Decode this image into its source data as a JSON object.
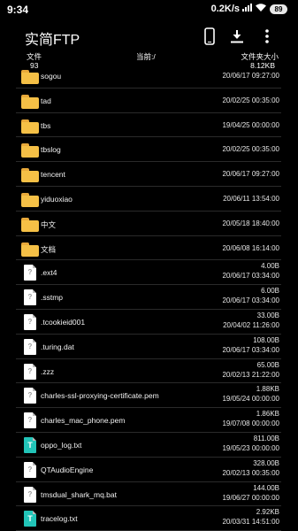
{
  "status_bar": {
    "time": "9:34",
    "speed": "0.2K/s",
    "battery": "89"
  },
  "title_bar": {
    "title": "实简FTP"
  },
  "header": {
    "left_label": "文件",
    "left_count": "93",
    "center_path": "当前:/",
    "right_label": "文件夹大小",
    "right_size": "8.12KB"
  },
  "files": [
    {
      "name": "sogou",
      "type": "folder",
      "size": "",
      "date": "20/06/17 09:27:00"
    },
    {
      "name": "tad",
      "type": "folder",
      "size": "",
      "date": "20/02/25 00:35:00"
    },
    {
      "name": "tbs",
      "type": "folder",
      "size": "",
      "date": "19/04/25 00:00:00"
    },
    {
      "name": "tbslog",
      "type": "folder",
      "size": "",
      "date": "20/02/25 00:35:00"
    },
    {
      "name": "tencent",
      "type": "folder",
      "size": "",
      "date": "20/06/17 09:27:00"
    },
    {
      "name": "yiduoxiao",
      "type": "folder",
      "size": "",
      "date": "20/06/11 13:54:00"
    },
    {
      "name": "中文",
      "type": "folder",
      "size": "",
      "date": "20/05/18 18:40:00"
    },
    {
      "name": "文档",
      "type": "folder",
      "size": "",
      "date": "20/06/08 16:14:00"
    },
    {
      "name": ".ext4",
      "type": "unknown",
      "size": "4.00B",
      "date": "20/06/17 03:34:00"
    },
    {
      "name": ".sstmp",
      "type": "unknown",
      "size": "6.00B",
      "date": "20/06/17 03:34:00"
    },
    {
      "name": ".tcookieid001",
      "type": "unknown",
      "size": "33.00B",
      "date": "20/04/02 11:26:00"
    },
    {
      "name": ".turing.dat",
      "type": "unknown",
      "size": "108.00B",
      "date": "20/06/17 03:34:00"
    },
    {
      "name": ".zzz",
      "type": "unknown",
      "size": "65.00B",
      "date": "20/02/13 21:22:00"
    },
    {
      "name": "charles-ssl-proxying-certificate.pem",
      "type": "unknown",
      "size": "1.88KB",
      "date": "19/05/24 00:00:00"
    },
    {
      "name": "charles_mac_phone.pem",
      "type": "unknown",
      "size": "1.86KB",
      "date": "19/07/08 00:00:00"
    },
    {
      "name": "oppo_log.txt",
      "type": "text",
      "size": "811.00B",
      "date": "19/05/23 00:00:00"
    },
    {
      "name": "QTAudioEngine",
      "type": "unknown",
      "size": "328.00B",
      "date": "20/02/13 00:35:00"
    },
    {
      "name": "tmsdual_shark_mq.bat",
      "type": "unknown",
      "size": "144.00B",
      "date": "19/06/27 00:00:00"
    },
    {
      "name": "tracelog.txt",
      "type": "text",
      "size": "2.92KB",
      "date": "20/03/31 14:51:00"
    }
  ]
}
